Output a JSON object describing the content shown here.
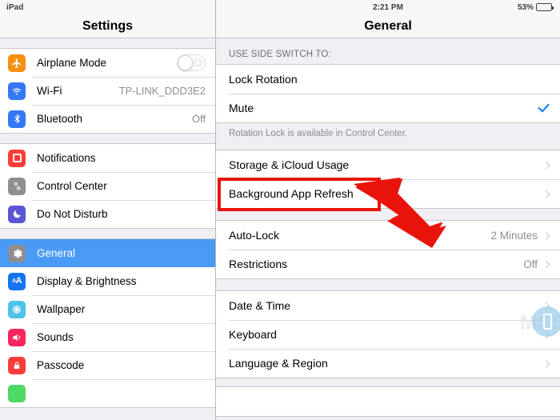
{
  "device": {
    "name": "iPad",
    "time": "2:21 PM",
    "battery_percent": "53%",
    "battery_level": 53
  },
  "sidebar": {
    "title": "Settings",
    "groups": [
      {
        "items": [
          {
            "label": "Airplane Mode",
            "icon": "airplane-icon",
            "icon_color": "#f59011",
            "control": "toggle",
            "toggle_on": false
          },
          {
            "label": "Wi-Fi",
            "icon": "wifi-icon",
            "icon_color": "#3478f6",
            "value": "TP-LINK_DDD3E2"
          },
          {
            "label": "Bluetooth",
            "icon": "bluetooth-icon",
            "icon_color": "#3478f6",
            "value": "Off"
          }
        ]
      },
      {
        "items": [
          {
            "label": "Notifications",
            "icon": "notifications-icon",
            "icon_color": "#fc3d39"
          },
          {
            "label": "Control Center",
            "icon": "control-center-icon",
            "icon_color": "#8e8e93"
          },
          {
            "label": "Do Not Disturb",
            "icon": "moon-icon",
            "icon_color": "#5a56d6"
          }
        ]
      },
      {
        "items": [
          {
            "label": "General",
            "icon": "gear-icon",
            "icon_color": "#8e8e93",
            "selected": true
          },
          {
            "label": "Display & Brightness",
            "icon": "display-brightness-icon",
            "icon_color": "#1574f0"
          },
          {
            "label": "Wallpaper",
            "icon": "wallpaper-icon",
            "icon_color": "#4fc3e8"
          },
          {
            "label": "Sounds",
            "icon": "sounds-icon",
            "icon_color": "#f8265c"
          },
          {
            "label": "Passcode",
            "icon": "passcode-lock-icon",
            "icon_color": "#fc3d39"
          },
          {
            "label": "",
            "icon": "privacy-icon",
            "icon_color": "#4cd964",
            "partial": true
          }
        ]
      }
    ],
    "selected_accent": "#4a9bf7"
  },
  "detail": {
    "title": "General",
    "sections": [
      {
        "header": "USE SIDE SWITCH TO:",
        "footer": "Rotation Lock is available in Control Center.",
        "rows": [
          {
            "label": "Lock Rotation",
            "accessory": "none"
          },
          {
            "label": "Mute",
            "accessory": "check"
          }
        ]
      },
      {
        "header": "",
        "footer": "",
        "rows": [
          {
            "label": "Storage & iCloud Usage",
            "accessory": "chevron"
          },
          {
            "label": "Background App Refresh",
            "accessory": "chevron",
            "highlighted": true
          }
        ]
      },
      {
        "header": "",
        "footer": "",
        "rows": [
          {
            "label": "Auto-Lock",
            "value": "2 Minutes",
            "accessory": "chevron"
          },
          {
            "label": "Restrictions",
            "value": "Off",
            "accessory": "chevron"
          }
        ]
      },
      {
        "header": "",
        "footer": "",
        "rows": [
          {
            "label": "Date & Time",
            "accessory": "chevron"
          },
          {
            "label": "Keyboard",
            "accessory": "chevron"
          },
          {
            "label": "Language & Region",
            "accessory": "chevron"
          }
        ]
      }
    ]
  },
  "annotations": {
    "highlight_color": "#e8140c",
    "highlight_target": "Background App Refresh",
    "arrow_color": "#e8140c",
    "arrow_points_to": "Background App Refresh"
  },
  "watermark": {
    "text": "MOBIGYAAN",
    "logo": "phone-circle-icon"
  }
}
